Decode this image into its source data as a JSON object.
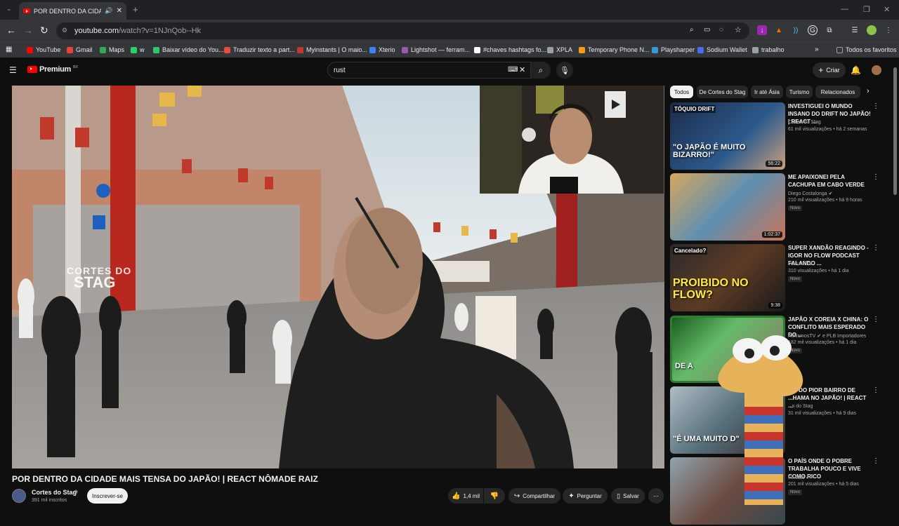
{
  "browser": {
    "tab_title": "POR DENTRO DA CIDADE MAIS TENSA DO JAPÃO! | REACT NÔMADE RAIZ",
    "new_tab": "+",
    "url_host": "youtube.com",
    "url_path": "/watch?v=1NJnQob--Hk",
    "bookmarks": [
      {
        "label": "YouTube",
        "color": "#ff0000"
      },
      {
        "label": "Gmail",
        "color": "#ea4335"
      },
      {
        "label": "Maps",
        "color": "#34a853"
      },
      {
        "label": "w",
        "color": "#25d366"
      },
      {
        "label": "Baixar vídeo do You...",
        "color": "#2ec866"
      },
      {
        "label": "Traduzir texto a part...",
        "color": "#e74c3c"
      },
      {
        "label": "Myinstants | O maio...",
        "color": "#c0392b"
      },
      {
        "label": "Xterio",
        "color": "#3b82f6"
      },
      {
        "label": "Lightshot — ferram...",
        "color": "#9b59b6"
      },
      {
        "label": "#chaves hashtags fo...",
        "color": "#ffffff"
      },
      {
        "label": "XPLA",
        "color": "#9aa0a6"
      },
      {
        "label": "Temporary Phone N...",
        "color": "#f39c12"
      },
      {
        "label": "Playsharper",
        "color": "#3498db"
      },
      {
        "label": "Sodium Wallet",
        "color": "#4f6bed"
      },
      {
        "label": "trabalho",
        "color": "#9aa0a6"
      }
    ],
    "bookmarks_more": "»",
    "all_bookmarks": "Todos os favoritos"
  },
  "youtube": {
    "logo": "Premium",
    "logo_region": "BR",
    "search_value": "rust",
    "create_label": "Criar"
  },
  "video": {
    "title": "POR DENTRO DA CIDADE MAIS TENSA DO JAPÃO! | REACT NÔMADE RAIZ",
    "watermark_top": "CORTES DO",
    "watermark_bottom": "STAG",
    "channel": "Cortes do Stag",
    "subscribers": "391 mil inscritos",
    "subscribe_label": "Inscrever-se",
    "likes": "1,4 mil",
    "share_label": "Compartilhar",
    "ask_label": "Perguntar",
    "save_label": "Salvar",
    "more_label": "⋯"
  },
  "chips": [
    "Todos",
    "De Cortes do Stag",
    "Ir até Ásia",
    "Turismo",
    "Relacionados"
  ],
  "recommendations": [
    {
      "title": "INVESTIGUEI O MUNDO INSANO DO DRIFT NO JAPÃO! | REACT ...",
      "channel": "Cortes do Stag",
      "meta": "61 mil visualizações • há 2 semanas",
      "duration": "56:22",
      "badge": "",
      "thumb_text": "\"O JAPÃO É MUITO BIZARRO!\"",
      "corner_text": "TÓQUIO DRIFT"
    },
    {
      "title": "ME APAIXONEI PELA CACHUPA EM CABO VERDE",
      "channel": "Diego Costalonga ✔",
      "meta": "210 mil visualizações • há 9 horas",
      "duration": "1:02:37",
      "badge": "Novo",
      "thumb_text": "",
      "corner_text": ""
    },
    {
      "title": "SUPER XANDÃO REAGINDO - IGOR NO FLOW PODCAST FALANDO ...",
      "channel": "Inosuke Tv",
      "meta": "310 visualizações • há 1 dia",
      "duration": "9:38",
      "badge": "Novo",
      "thumb_text": "PROIBIDO NO FLOW?",
      "corner_text": "Cancelado?"
    },
    {
      "title": "JAPÃO X COREIA X CHINA: O CONFLITO MAIS ESPERADO DO ...",
      "channel": "AchismosTV ✔ e PLB Importadores",
      "meta": "182 mil visualizações • há 1 dia",
      "duration": "",
      "badge": "Novo",
      "thumb_text": "DE A",
      "corner_text": ""
    },
    {
      "title": "...O DO PIOR BAIRRO DE ...HAMA NO JAPÃO! | REACT ...",
      "channel": "...s do Stag",
      "meta": "31 mil visualizações • há 9 dias",
      "duration": "55:46",
      "badge": "",
      "thumb_text": "\"É UMA MUITO D\"",
      "corner_text": ""
    },
    {
      "title": "O PAÍS ONDE O POBRE TRABALHA POUCO E VIVE COMO RICO",
      "channel": "Fe Leal ✔",
      "meta": "201 mil visualizações • há 5 dias",
      "duration": "",
      "badge": "Novo",
      "thumb_text": "",
      "corner_text": ""
    }
  ]
}
